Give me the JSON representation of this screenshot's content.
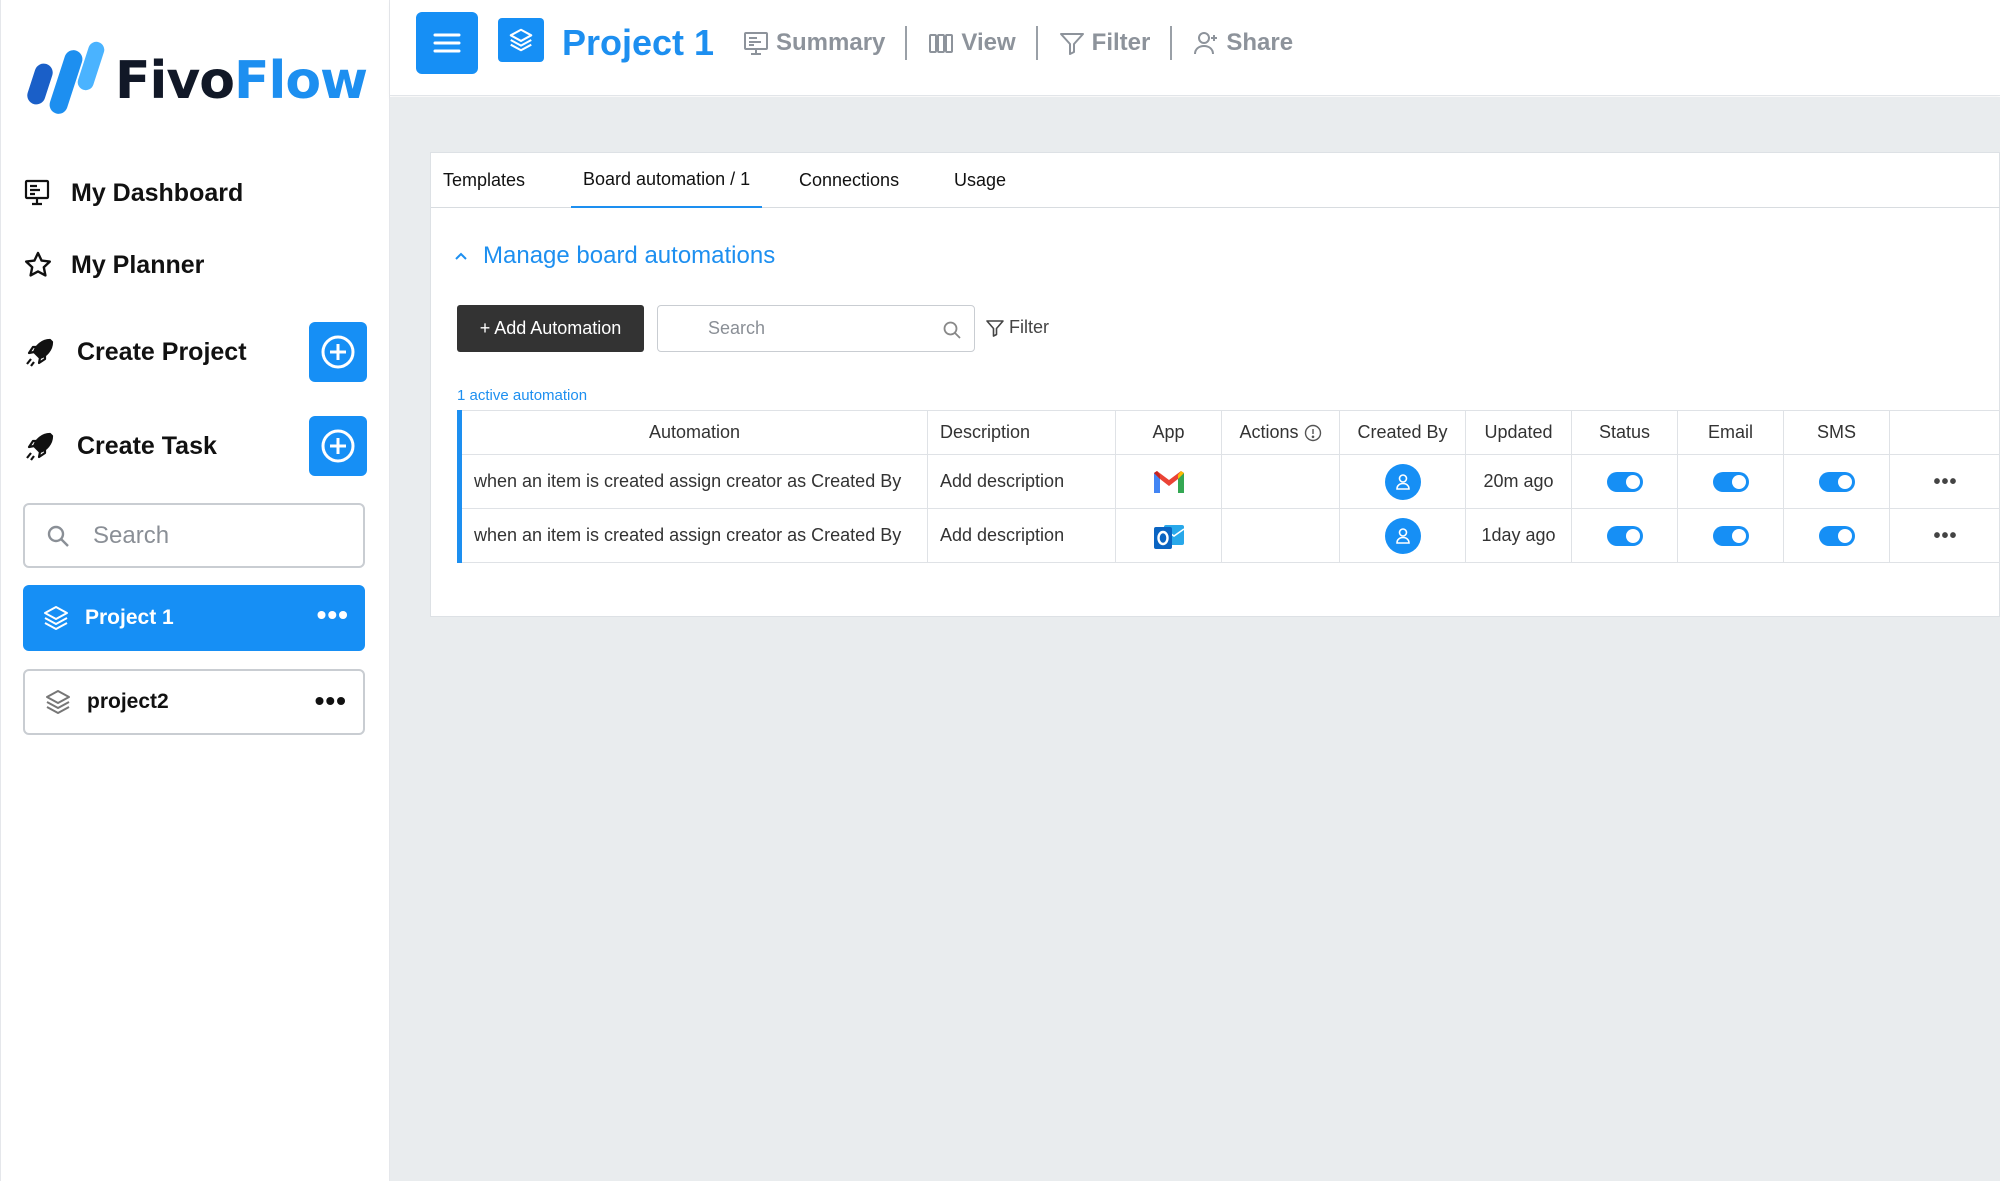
{
  "brand": {
    "name_part1": "Fivo",
    "name_part2": "Flow",
    "accent": "#1d8ff0"
  },
  "sidebar": {
    "nav": [
      {
        "label": "My Dashboard",
        "icon": "dashboard-icon"
      },
      {
        "label": "My Planner",
        "icon": "star-icon"
      }
    ],
    "create": [
      {
        "label": "Create Project",
        "icon": "rocket-icon"
      },
      {
        "label": "Create Task",
        "icon": "rocket-icon"
      }
    ],
    "search_placeholder": "Search",
    "projects": [
      {
        "name": "Project 1",
        "active": true
      },
      {
        "name": "project2",
        "active": false
      }
    ]
  },
  "topbar": {
    "project_title": "Project 1",
    "links": [
      {
        "label": "Summary",
        "icon": "summary-icon"
      },
      {
        "label": "View",
        "icon": "columns-icon"
      },
      {
        "label": "Filter",
        "icon": "filter-icon"
      },
      {
        "label": "Share",
        "icon": "user-add-icon"
      }
    ]
  },
  "main": {
    "tabs": [
      {
        "label": "Templates",
        "active": false
      },
      {
        "label": "Board automation / 1",
        "active": true
      },
      {
        "label": "Connections",
        "active": false
      },
      {
        "label": "Usage",
        "active": false
      }
    ],
    "section_title": "Manage board automations",
    "add_button": "+ Add Automation",
    "search_placeholder": "Search",
    "filter_label": "Filter",
    "active_count": "1 active automation",
    "table": {
      "headers": [
        "Automation",
        "Description",
        "App",
        "Actions",
        "Created By",
        "Updated",
        "Status",
        "Email",
        "SMS",
        ""
      ],
      "rows": [
        {
          "automation": "when an item is created assign creator as Created By",
          "description": "Add description",
          "app": "gmail-icon",
          "actions": "",
          "updated": "20m ago",
          "status": true,
          "email": true,
          "sms": true
        },
        {
          "automation": "when an item is created assign creator as Created By",
          "description": "Add description",
          "app": "outlook-icon",
          "actions": "",
          "updated": "1day ago",
          "status": true,
          "email": true,
          "sms": true
        }
      ]
    }
  }
}
